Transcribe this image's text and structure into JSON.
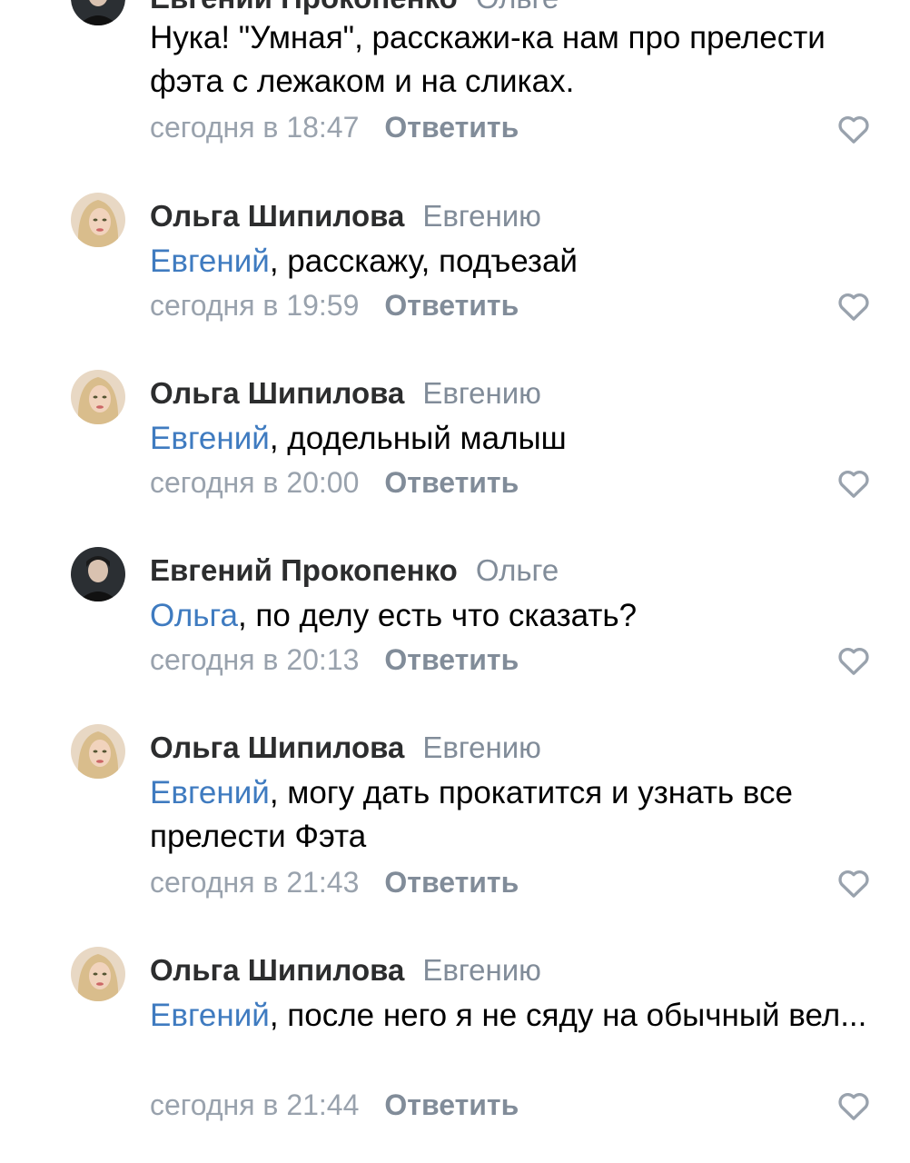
{
  "comments": [
    {
      "author": "Евгений Прокопенко",
      "reply_to": "Ольге",
      "mention": "",
      "text": "Нука! \"Умная\", расскажи-ка нам про прелести фэта с лежаком и на сликах.",
      "time": "сегодня в 18:47",
      "reply_label": "Ответить",
      "avatar": "man-avatar"
    },
    {
      "author": "Ольга Шипилова",
      "reply_to": "Евгению",
      "mention": "Евгений",
      "text": ", расскажу, подъезай",
      "time": "сегодня в 19:59",
      "reply_label": "Ответить",
      "avatar": "woman-avatar"
    },
    {
      "author": "Ольга Шипилова",
      "reply_to": "Евгению",
      "mention": "Евгений",
      "text": ", додельный малыш",
      "time": "сегодня в 20:00",
      "reply_label": "Ответить",
      "avatar": "woman-avatar"
    },
    {
      "author": "Евгений Прокопенко",
      "reply_to": "Ольге",
      "mention": "Ольга",
      "text": ", по делу есть что сказать?",
      "time": "сегодня в 20:13",
      "reply_label": "Ответить",
      "avatar": "man-avatar"
    },
    {
      "author": "Ольга Шипилова",
      "reply_to": "Евгению",
      "mention": "Евгений",
      "text": ", могу дать прокатится и узнать все прелести Фэта",
      "time": "сегодня в 21:43",
      "reply_label": "Ответить",
      "avatar": "woman-avatar"
    },
    {
      "author": "Ольга Шипилова",
      "reply_to": "Евгению",
      "mention": "Евгений",
      "text": ", после него я не сяду на обычный вел...",
      "time": "сегодня в 21:44",
      "reply_label": "Ответить",
      "avatar": "woman-avatar"
    }
  ],
  "colors": {
    "author": "#2c2d2e",
    "secondary": "#818c99",
    "mention": "#3f7bc0",
    "text": "#000000"
  }
}
